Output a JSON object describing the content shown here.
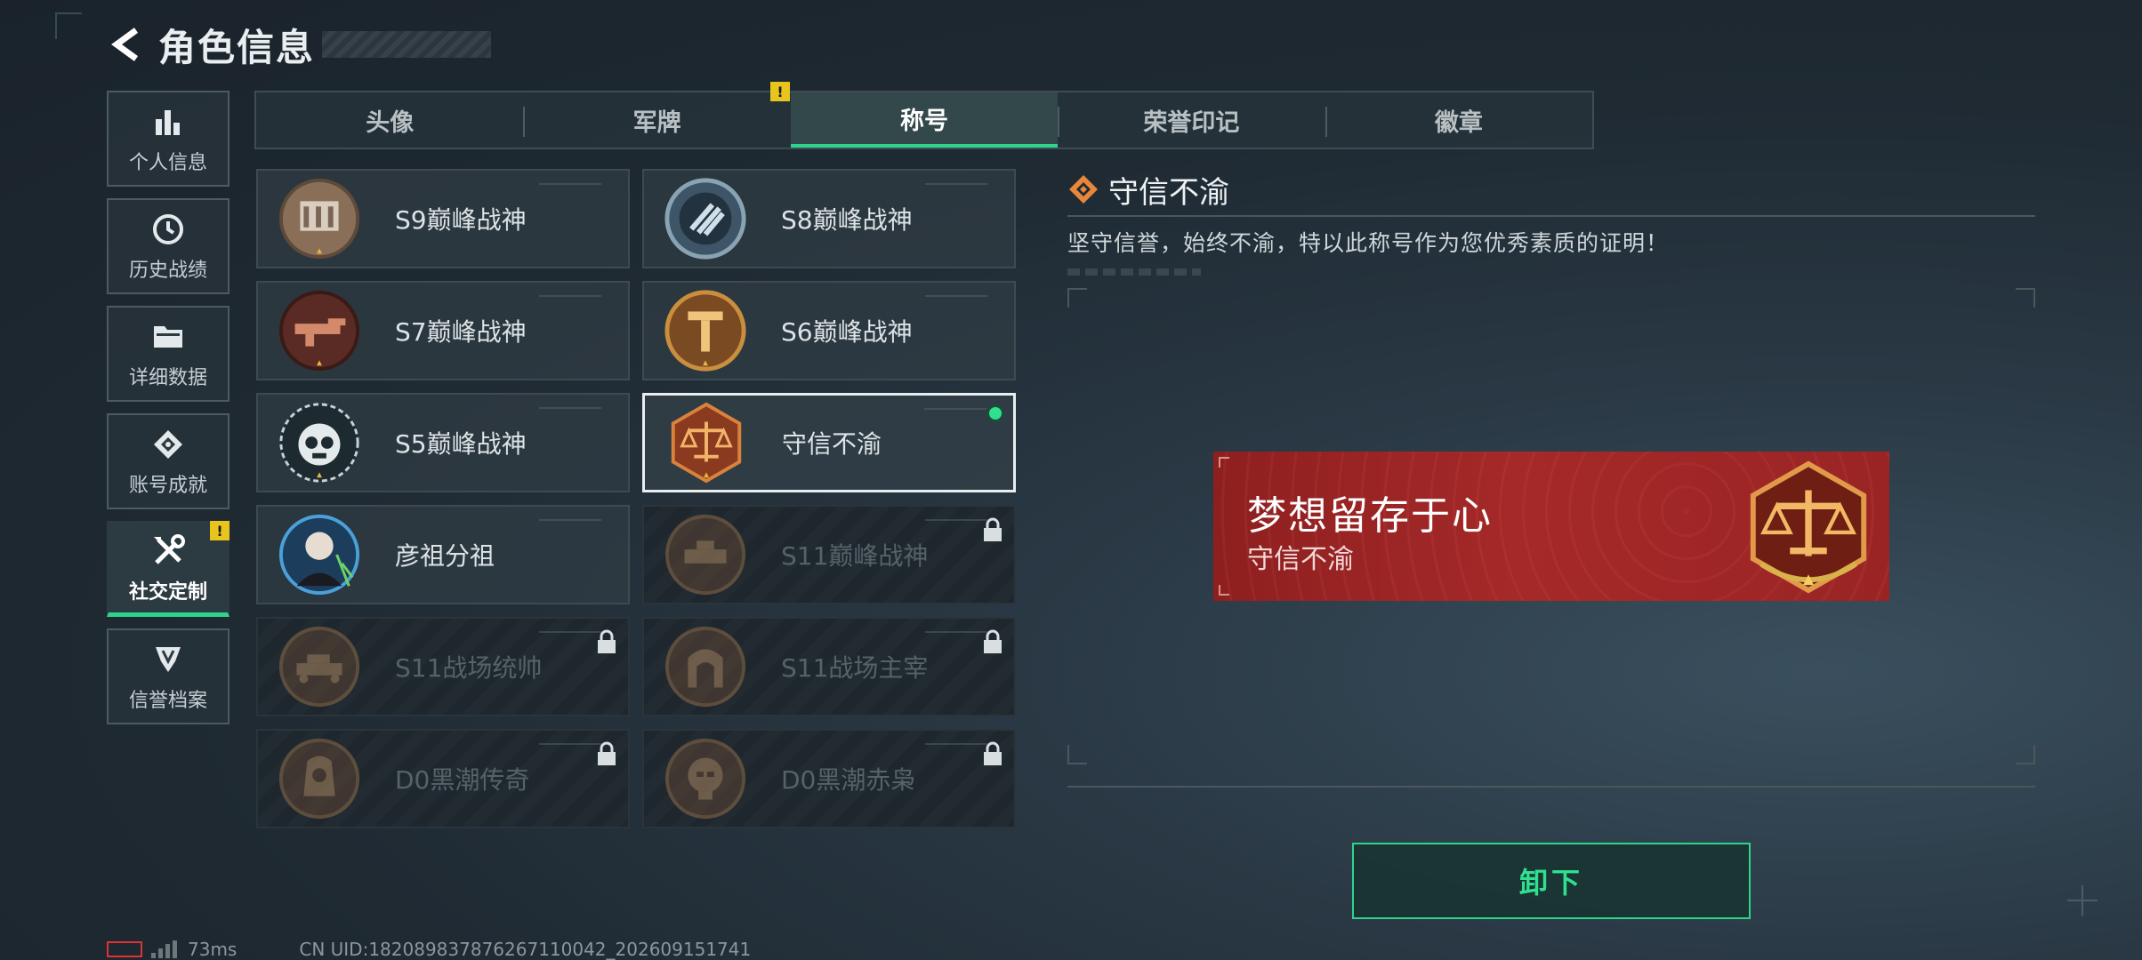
{
  "header": {
    "title": "角色信息"
  },
  "sidebar": {
    "items": [
      {
        "label": "个人信息"
      },
      {
        "label": "历史战绩"
      },
      {
        "label": "详细数据"
      },
      {
        "label": "账号成就"
      },
      {
        "label": "社交定制",
        "active": true,
        "badge": "!"
      },
      {
        "label": "信誉档案"
      }
    ]
  },
  "tabs": [
    {
      "label": "头像"
    },
    {
      "label": "军牌",
      "badge": "!"
    },
    {
      "label": "称号",
      "active": true
    },
    {
      "label": "荣誉印记"
    },
    {
      "label": "徽章"
    }
  ],
  "titles": [
    {
      "name": "S9巅峰战神",
      "locked": false
    },
    {
      "name": "S8巅峰战神",
      "locked": false
    },
    {
      "name": "S7巅峰战神",
      "locked": false
    },
    {
      "name": "S6巅峰战神",
      "locked": false
    },
    {
      "name": "S5巅峰战神",
      "locked": false
    },
    {
      "name": "守信不渝",
      "locked": false,
      "selected": true,
      "equipped": true
    },
    {
      "name": "彦祖分祖",
      "locked": false
    },
    {
      "name": "S11巅峰战神",
      "locked": true
    },
    {
      "name": "S11战场统帅",
      "locked": true
    },
    {
      "name": "S11战场主宰",
      "locked": true
    },
    {
      "name": "D0黑潮传奇",
      "locked": true
    },
    {
      "name": "D0黑潮赤枭",
      "locked": true
    }
  ],
  "detail": {
    "title": "守信不渝",
    "description": "坚守信誉，始终不渝，特以此称号作为您优秀素质的证明！",
    "banner_title": "梦想留存于心",
    "banner_subtitle": "守信不渝"
  },
  "actions": {
    "unequip_label": "卸下"
  },
  "footer": {
    "ping": "73ms",
    "uid": "CN UID:1820898378762671100​42_202609151741"
  },
  "colors": {
    "accent": "#2fd48c",
    "warning": "#e8c51d",
    "banner": "#a52929"
  }
}
